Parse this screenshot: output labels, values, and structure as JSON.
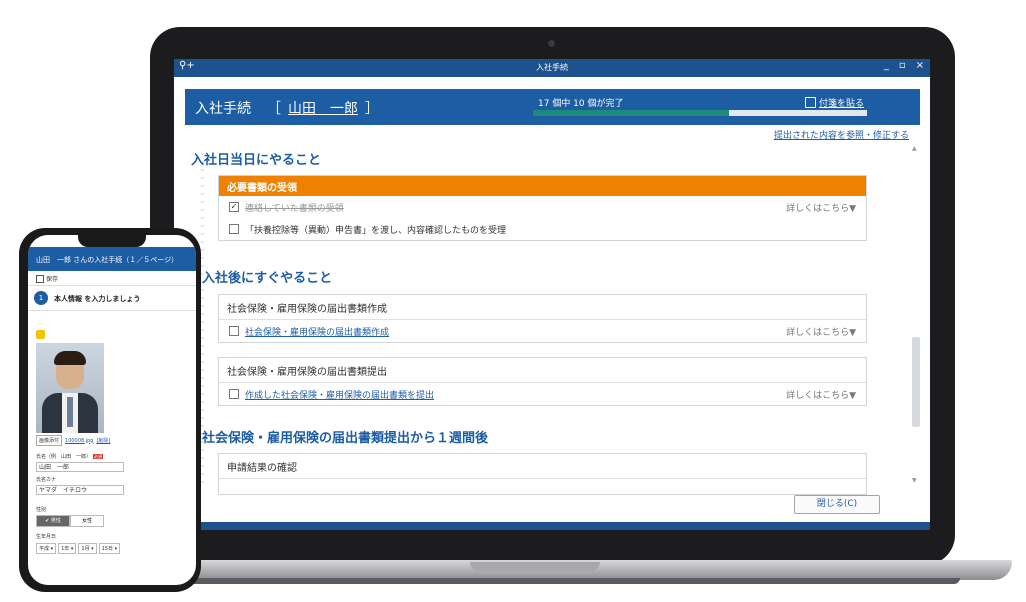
{
  "window": {
    "title": "入社手続",
    "controls": [
      "_",
      "▫",
      "×"
    ]
  },
  "header": {
    "title": "入社手続",
    "bracket_open": "［",
    "employee_name": "山田　一郎",
    "bracket_close": "］",
    "progress_text": "17 個中 10 個が完了",
    "progress": {
      "completed": 10,
      "total": 17
    },
    "sticky_label": "付箋を貼る"
  },
  "reference_link": "提出された内容を参照・修正する",
  "sections": [
    {
      "heading": "入社日当日にやること",
      "cards": [
        {
          "title": "必要書類の受領",
          "style": "orange",
          "tasks": [
            {
              "text": "連絡していた書類の受領",
              "checked": true,
              "detail": "詳しくはこちら▼"
            },
            {
              "text": "「扶養控除等（異動）申告書」を渡し、内容確認したものを受理",
              "checked": false,
              "detail": ""
            }
          ]
        }
      ]
    },
    {
      "heading": "入社後にすぐやること",
      "cards": [
        {
          "title": "社会保険・雇用保険の届出書類作成",
          "style": "plain",
          "tasks": [
            {
              "text": "社会保険・雇用保険の届出書類作成",
              "checked": false,
              "detail": "詳しくはこちら▼"
            }
          ]
        },
        {
          "title": "社会保険・雇用保険の届出書類提出",
          "style": "plain",
          "tasks": [
            {
              "text": "作成した社会保険・雇用保険の届出書類を提出",
              "checked": false,
              "detail": "詳しくはこちら▼"
            }
          ]
        }
      ]
    },
    {
      "heading": "社会保険・雇用保険の届出書類提出から１週間後",
      "cards": [
        {
          "title": "申請結果の確認",
          "style": "plain",
          "tasks": []
        }
      ]
    }
  ],
  "close_button": "閉じる(C)",
  "phone": {
    "header": "山田　一郎 さんの入社手続（１／５ページ）",
    "save": "保存",
    "step_number": "1",
    "step_text": "本人情報 を入力しましょう",
    "file_button": "画像添付",
    "file_name": "100008.jpg",
    "file_delete": "[削除]",
    "name_label": "氏名（例　山田　一郎）",
    "required": "必須",
    "name_value": "山田　一郎",
    "kana_label": "氏名カナ",
    "kana_value": "ヤマダ　イチロウ",
    "gender_label": "性別",
    "gender_male": "✔ 男性",
    "gender_female": "女性",
    "birth_label": "生年月日",
    "birth_era": "平成 ▾",
    "birth_year": "1年 ▾",
    "birth_month": "1月 ▾",
    "birth_day": "15日 ▾"
  },
  "colors": {
    "brand": "#1c5da4",
    "accent_orange": "#ef8100",
    "progress": "#1d8a7b"
  }
}
